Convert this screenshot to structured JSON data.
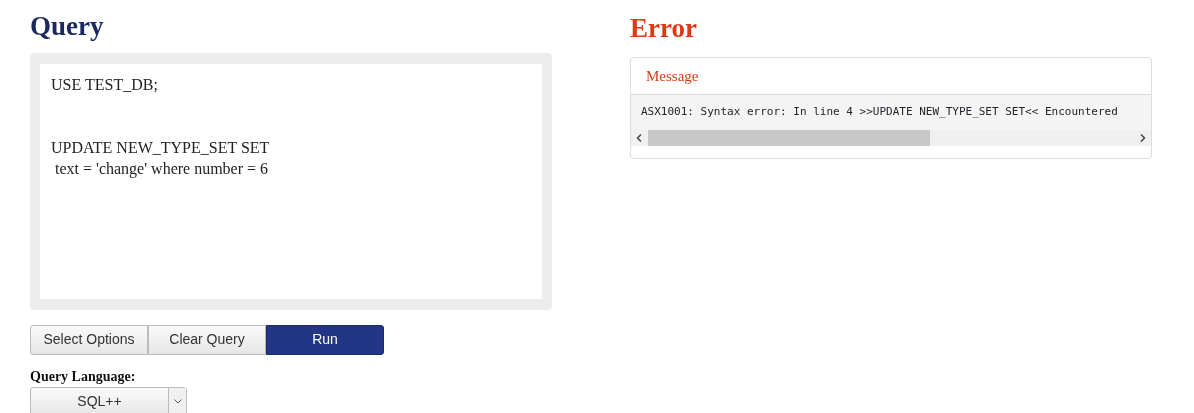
{
  "query": {
    "title": "Query",
    "text": "USE TEST_DB;\n\n\nUPDATE NEW_TYPE_SET SET\n text = 'change' where number = 6",
    "buttons": [
      {
        "label": "Select Options",
        "kind": "default"
      },
      {
        "label": "Clear Query",
        "kind": "default"
      },
      {
        "label": "Run",
        "kind": "primary"
      }
    ],
    "language": {
      "label": "Query Language:",
      "value": "SQL++"
    }
  },
  "error": {
    "title": "Error",
    "header": "Message",
    "message": "ASX1001: Syntax error: In line 4 >>UPDATE NEW_TYPE_SET SET<< Encountered"
  }
}
